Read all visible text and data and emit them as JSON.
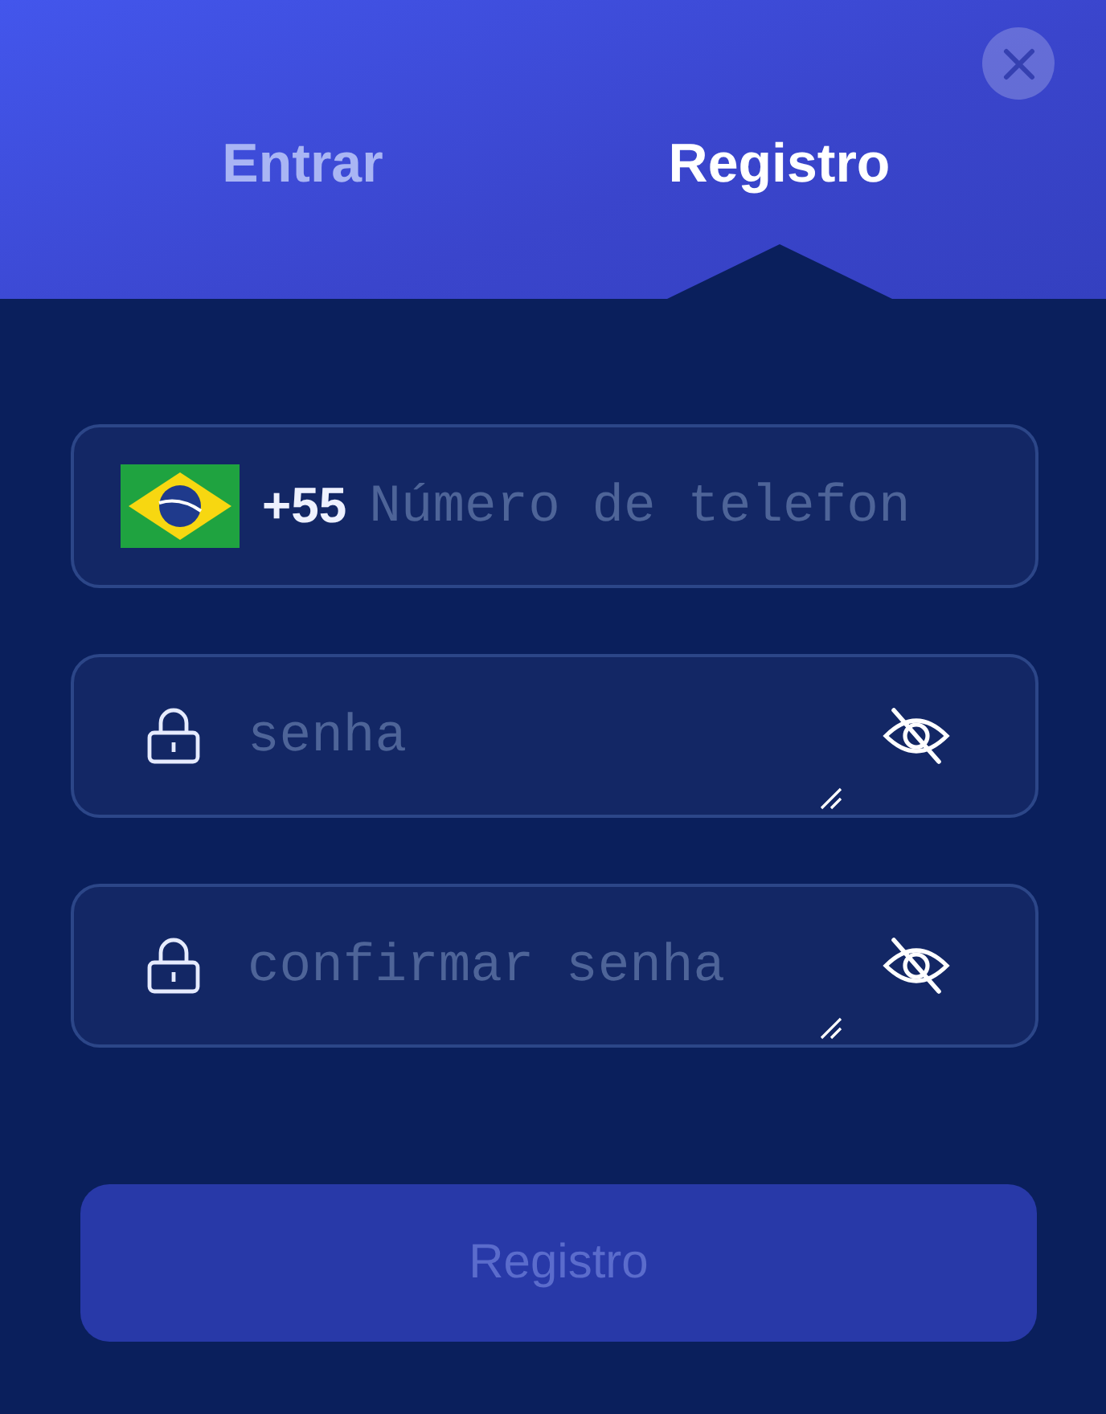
{
  "tabs": [
    {
      "label": "Entrar",
      "selected": false
    },
    {
      "label": "Registro",
      "selected": true
    }
  ],
  "fields": [
    {
      "kind": "phone",
      "country_code": "+55",
      "placeholder": "Número de telefon"
    },
    {
      "kind": "password",
      "placeholder": "senha"
    },
    {
      "kind": "password",
      "placeholder": "confirmar senha"
    }
  ],
  "submit": {
    "label": "Registro",
    "disabled": true
  }
}
